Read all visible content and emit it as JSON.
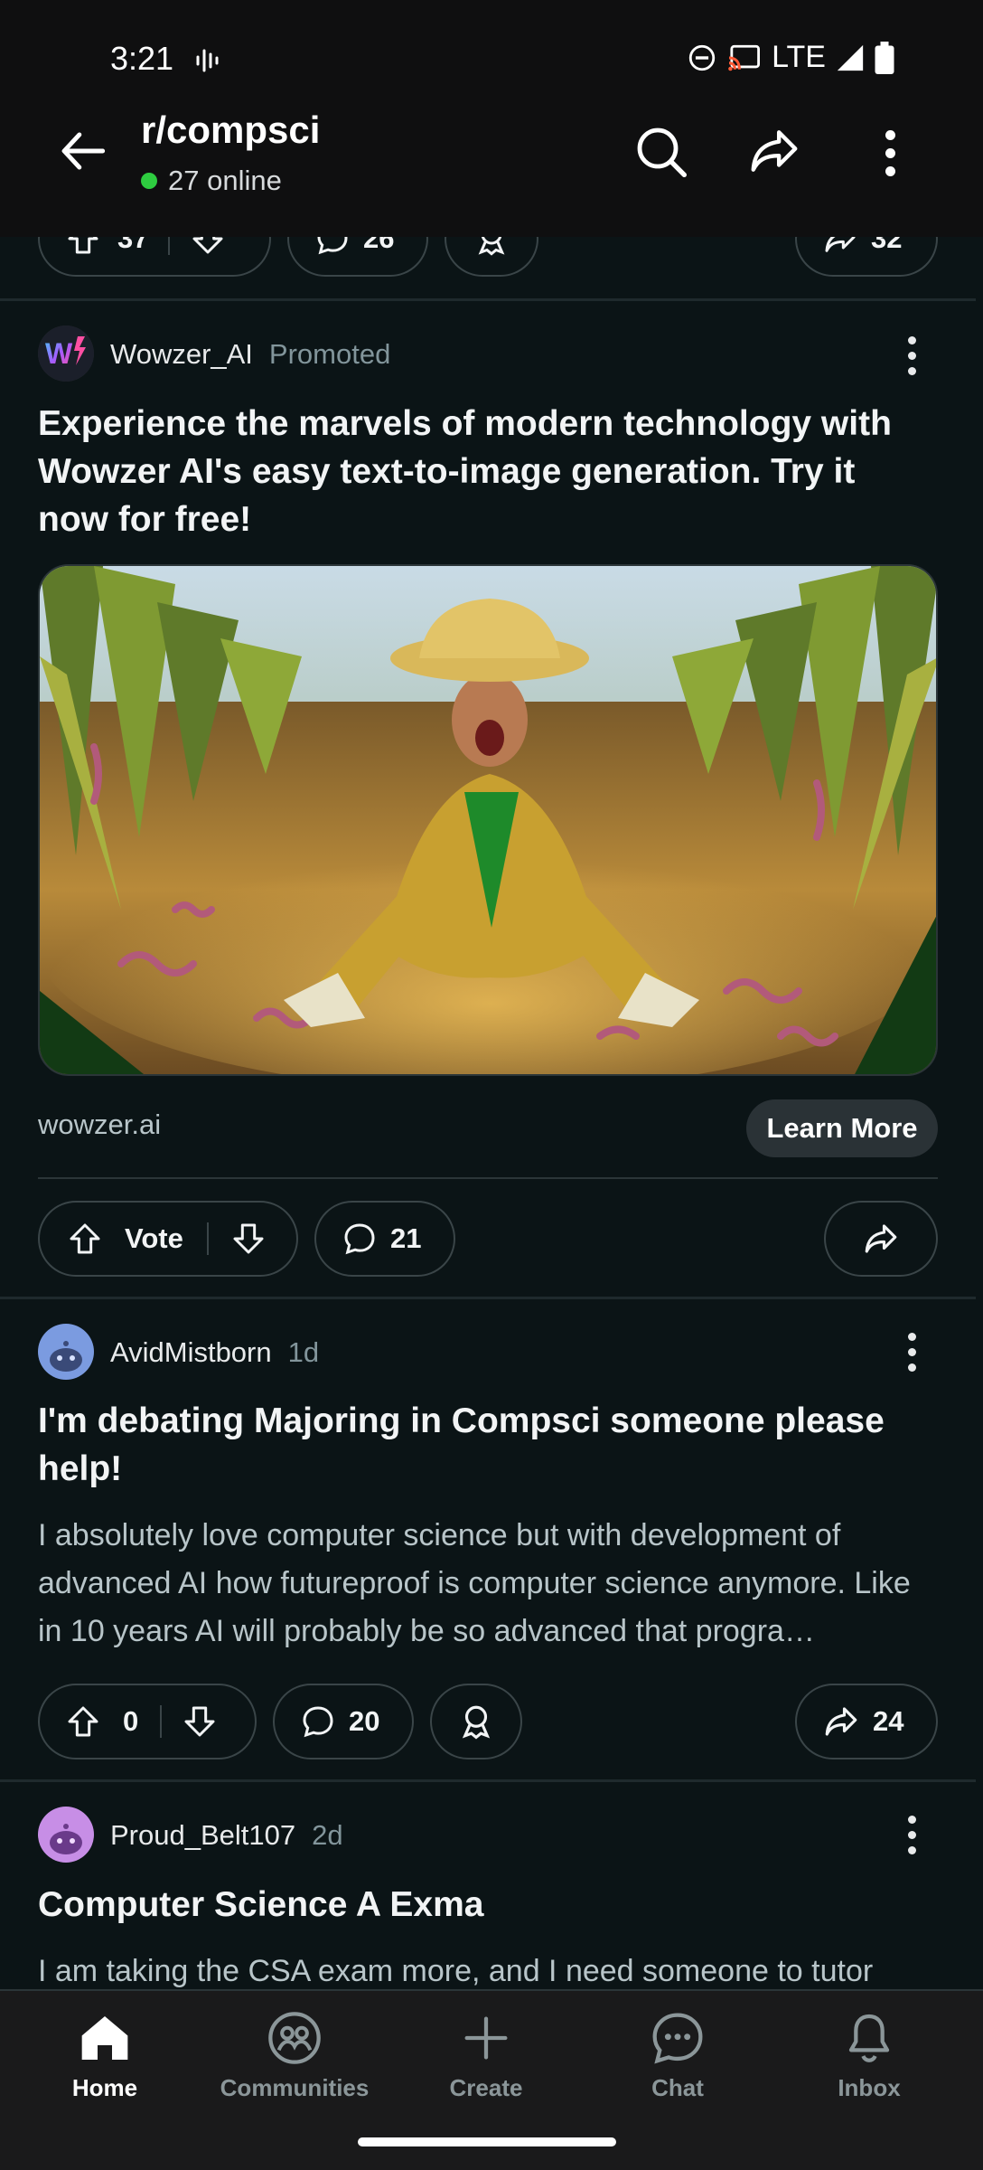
{
  "status_bar": {
    "time": "3:21",
    "network": "LTE"
  },
  "header": {
    "subreddit": "r/compsci",
    "online_count": "27 online"
  },
  "prev_post_actions": {
    "upvotes": "37",
    "comments": "26",
    "shares": "32"
  },
  "promoted_post": {
    "author": "Wowzer_AI",
    "label": "Promoted",
    "avatar_text": "W",
    "title": "Experience the marvels of modern technology with Wowzer AI's easy text-to-image generation. Try it now for free!",
    "domain": "wowzer.ai",
    "cta": "Learn More",
    "vote_label": "Vote",
    "comments": "21"
  },
  "posts": [
    {
      "author": "AvidMistborn",
      "age": "1d",
      "title": "I'm debating Majoring in Compsci someone please help!",
      "body": "I absolutely love computer science but with development of advanced AI how futureproof is computer science anymore. Like in 10 years AI will probably be so advanced that progra…",
      "votes": "0",
      "comments": "20",
      "shares": "24"
    },
    {
      "author": "Proud_Belt107",
      "age": "2d",
      "title": "Computer Science A Exma",
      "body": "I am taking the CSA exam more, and I need someone to tutor"
    }
  ],
  "bottom_nav": [
    {
      "label": "Home",
      "icon": "home-icon"
    },
    {
      "label": "Communities",
      "icon": "communities-icon"
    },
    {
      "label": "Create",
      "icon": "plus-icon"
    },
    {
      "label": "Chat",
      "icon": "chat-icon"
    },
    {
      "label": "Inbox",
      "icon": "bell-icon"
    }
  ],
  "colors": {
    "background": "#0b1416",
    "online_dot": "#2ecc40",
    "cta_bg": "#2a3236",
    "header_bg": "#0f0f10"
  }
}
